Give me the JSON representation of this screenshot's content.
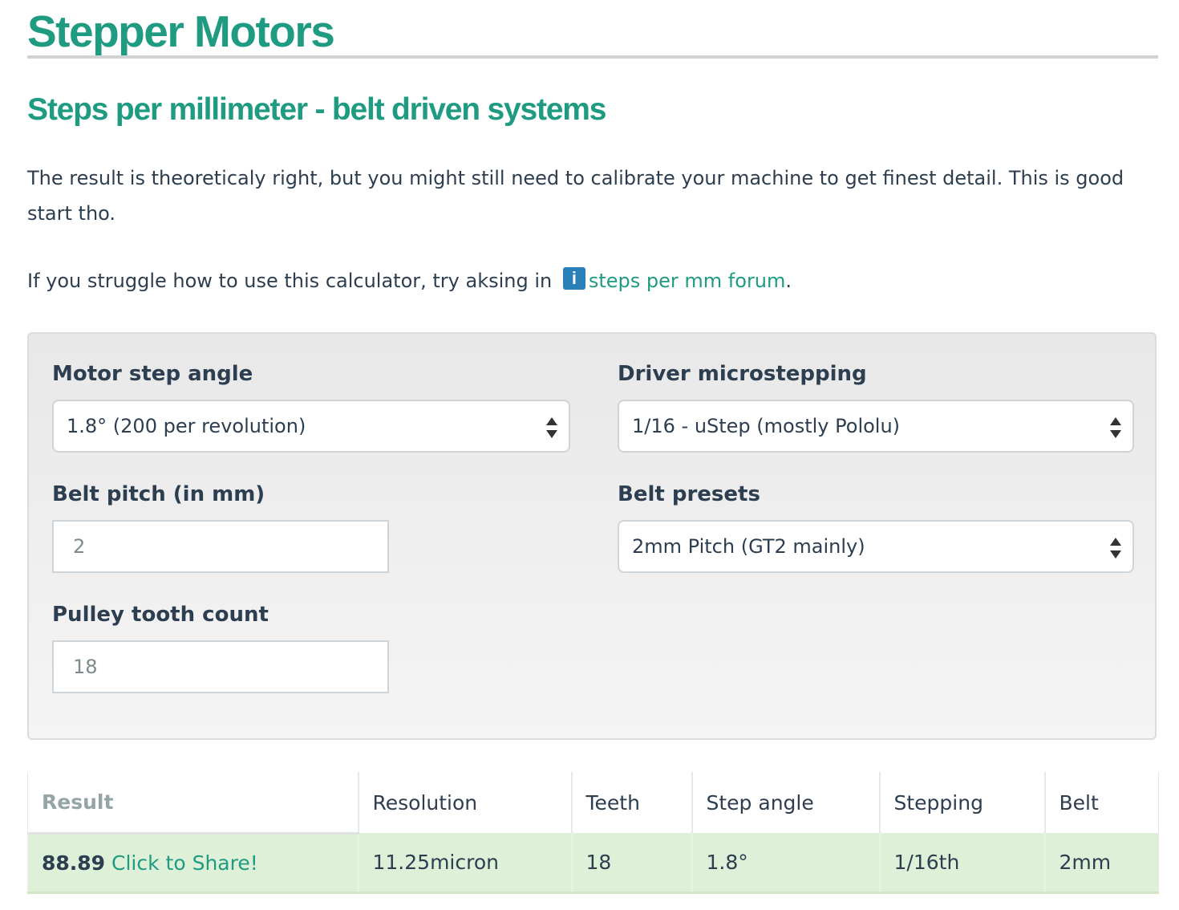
{
  "page": {
    "title": "Stepper Motors",
    "subtitle": "Steps per millimeter - belt driven systems",
    "intro": "The result is theoreticaly right, but you might still need to calibrate your machine to get finest detail. This is good start tho.",
    "help_prefix": "If you struggle how to use this calculator, try aksing in",
    "help_icon": "i",
    "help_link": "steps per mm forum",
    "help_suffix": "."
  },
  "form": {
    "motor_step_angle": {
      "label": "Motor step angle",
      "value": "1.8° (200 per revolution)"
    },
    "driver_microstepping": {
      "label": "Driver microstepping",
      "value": "1/16 - uStep (mostly Pololu)"
    },
    "belt_pitch": {
      "label": "Belt pitch (in mm)",
      "value": "2"
    },
    "belt_presets": {
      "label": "Belt presets",
      "value": "2mm Pitch (GT2 mainly)"
    },
    "pulley_tooth_count": {
      "label": "Pulley tooth count",
      "value": "18"
    }
  },
  "results": {
    "headers": [
      "Result",
      "Resolution",
      "Teeth",
      "Step angle",
      "Stepping",
      "Belt"
    ],
    "row": {
      "result": "88.89",
      "share": "Click to Share!",
      "resolution": "11.25micron",
      "teeth": "18",
      "step_angle": "1.8°",
      "stepping": "1/16th",
      "belt": "2mm"
    }
  },
  "colors": {
    "accent": "#1f9b81",
    "info_badge": "#2980b9",
    "result_row_bg": "#dff0d8",
    "text": "#2c3e50"
  },
  "icons": {
    "info": "info-icon",
    "select_arrows": "select-arrows-icon"
  }
}
